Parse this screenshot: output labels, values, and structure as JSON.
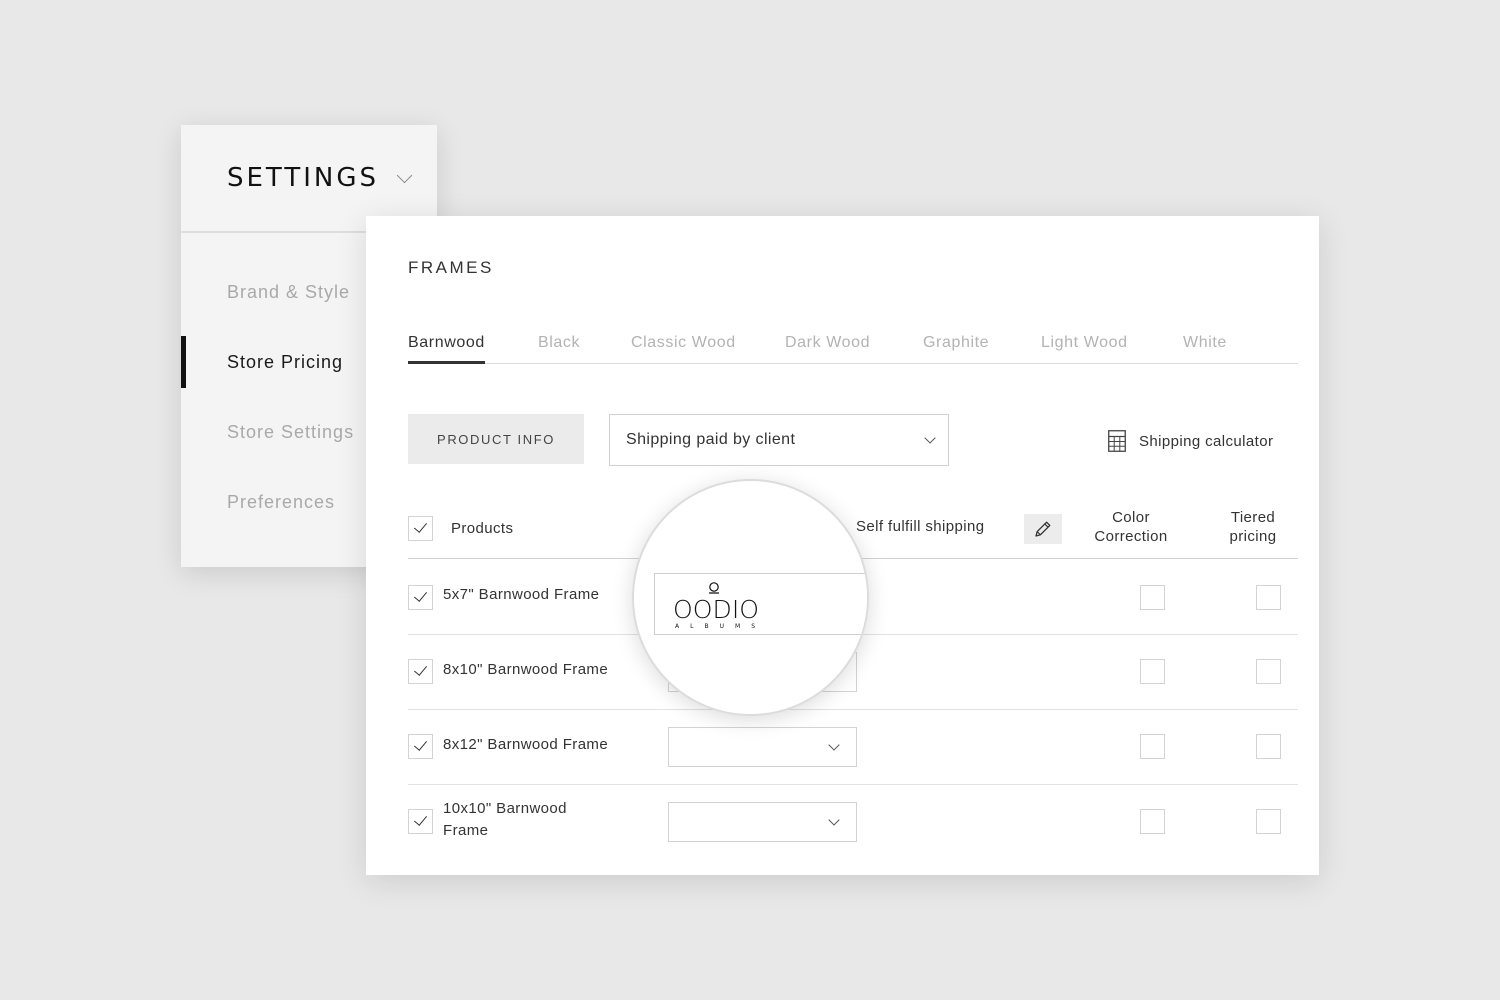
{
  "settings": {
    "title": "SETTINGS",
    "nav": [
      {
        "label": "Brand & Style",
        "active": false
      },
      {
        "label": "Store Pricing",
        "active": true
      },
      {
        "label": "Store Settings",
        "active": false
      },
      {
        "label": "Preferences",
        "active": false
      }
    ]
  },
  "main": {
    "section_title": "FRAMES",
    "tabs": [
      "Barnwood",
      "Black",
      "Classic Wood",
      "Dark Wood",
      "Graphite",
      "Light Wood",
      "White"
    ],
    "active_tab": "Barnwood",
    "product_info_label": "PRODUCT INFO",
    "shipping_select_value": "Shipping paid by client",
    "shipping_calculator_label": "Shipping calculator",
    "columns": {
      "products": "Products",
      "self_fulfill": "Self fulfill shipping",
      "color_correction": "Color Correction",
      "tiered_pricing": "Tiered pricing"
    },
    "rows": [
      {
        "name": "5x7\" Barnwood Frame",
        "checked": true,
        "color_correction": false,
        "tiered_pricing": false
      },
      {
        "name": "8x10\" Barnwood Frame",
        "checked": true,
        "color_correction": false,
        "tiered_pricing": false
      },
      {
        "name": "8x12\" Barnwood Frame",
        "checked": true,
        "color_correction": false,
        "tiered_pricing": false
      },
      {
        "name": "10x10\" Barnwood Frame",
        "checked": true,
        "color_correction": false,
        "tiered_pricing": false
      }
    ]
  },
  "magnifier": {
    "logo_text": "OODIO",
    "logo_subtext": "ALBUMS"
  },
  "icons": {
    "settings_chevron": "chevron-down-icon",
    "calculator": "calculator-icon",
    "edit": "pencil-icon",
    "check": "check-icon"
  }
}
